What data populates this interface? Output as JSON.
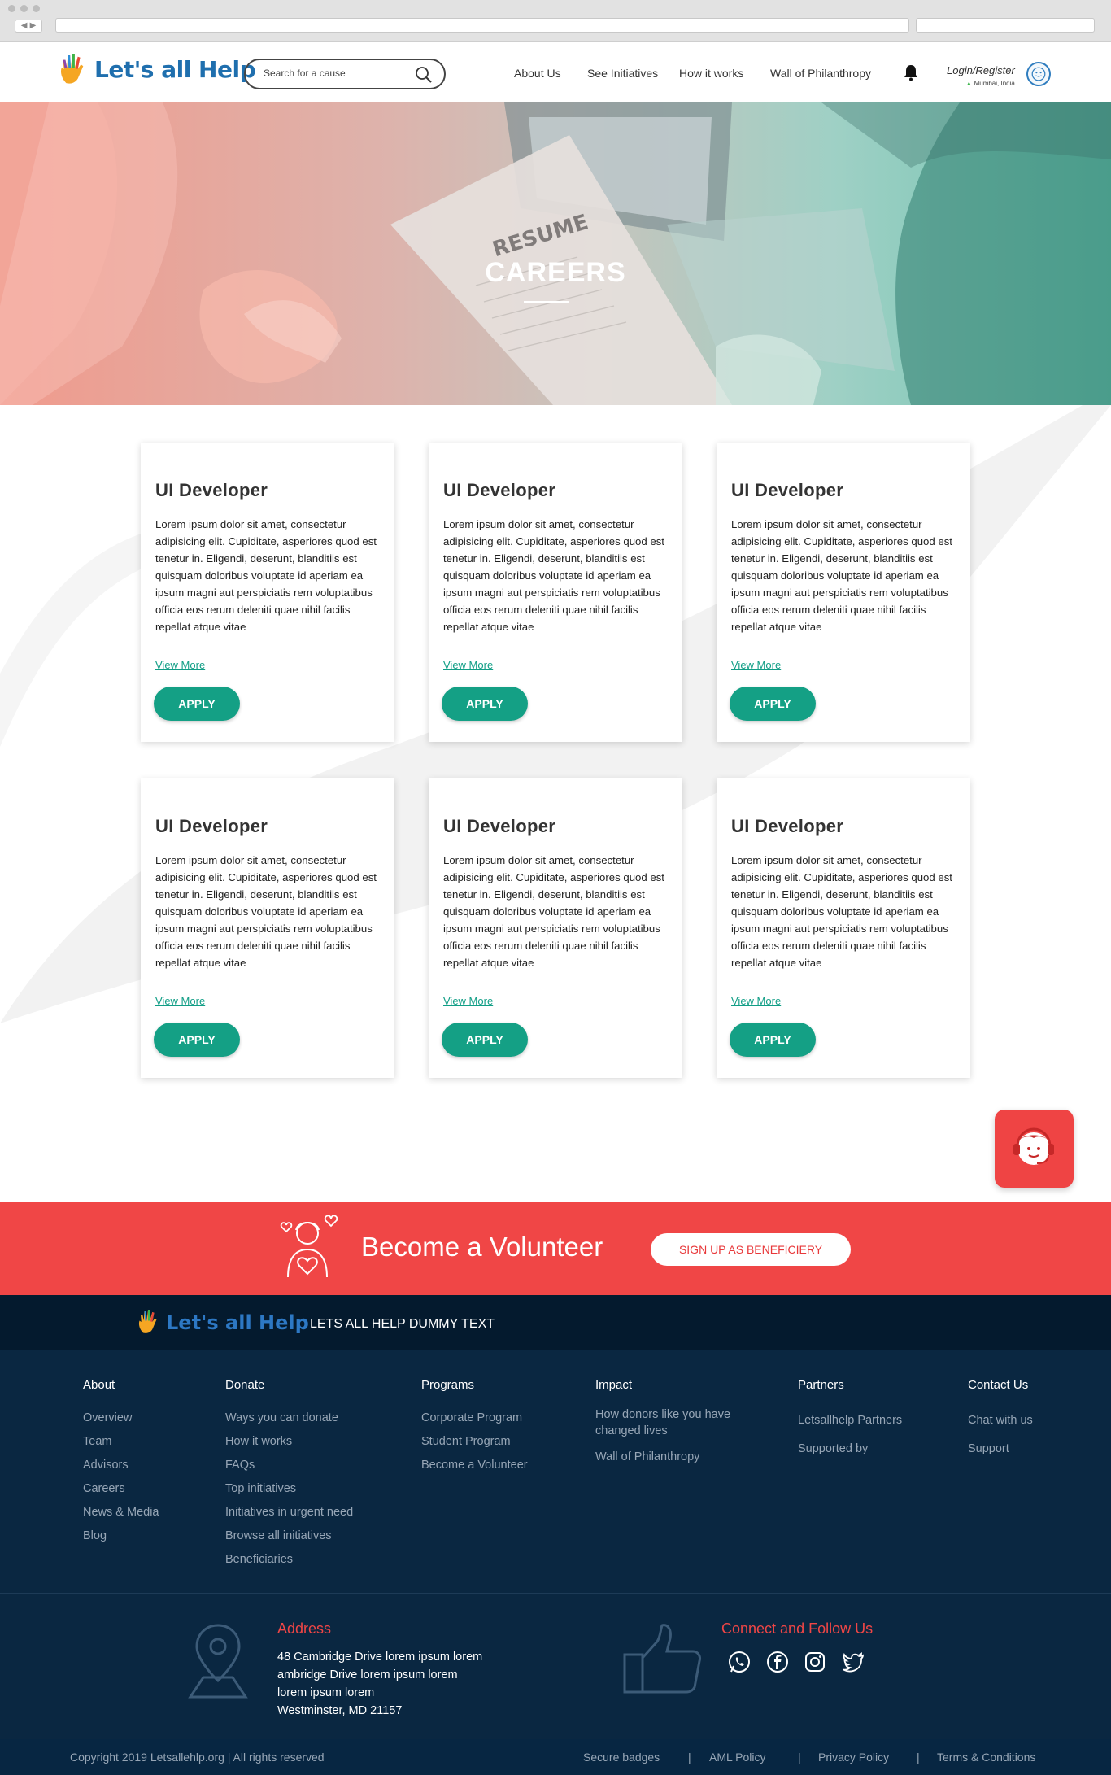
{
  "header": {
    "logo_text": "Let's all Help",
    "search_placeholder": "Search for a cause",
    "nav": [
      "About Us",
      "See Initiatives",
      "How it works",
      "Wall of Philanthropy"
    ],
    "login": "Login/Register",
    "location": "Mumbai, India"
  },
  "hero": {
    "resume_word": "RESUME",
    "title": "CAREERS"
  },
  "jobs": [
    {
      "title": "UI Developer",
      "description": "Lorem ipsum dolor sit amet, consectetur adipisicing elit. Cupiditate, asperiores quod est tenetur in. Eligendi, deserunt, blanditiis est quisquam doloribus voluptate id aperiam ea ipsum magni aut perspiciatis rem voluptatibus officia eos rerum deleniti quae nihil facilis repellat atque vitae",
      "more": "View More",
      "apply": "APPLY"
    },
    {
      "title": "UI Developer",
      "description": "Lorem ipsum dolor sit amet, consectetur adipisicing elit. Cupiditate, asperiores quod est tenetur in. Eligendi, deserunt, blanditiis est quisquam doloribus voluptate id aperiam ea ipsum magni aut perspiciatis rem voluptatibus officia eos rerum deleniti quae nihil facilis repellat atque vitae",
      "more": "View More",
      "apply": "APPLY"
    },
    {
      "title": "UI Developer",
      "description": "Lorem ipsum dolor sit amet, consectetur adipisicing elit. Cupiditate, asperiores quod est tenetur in. Eligendi, deserunt, blanditiis est quisquam doloribus voluptate id aperiam ea ipsum magni aut perspiciatis rem voluptatibus officia eos rerum deleniti quae nihil facilis repellat atque vitae",
      "more": "View More",
      "apply": "APPLY"
    },
    {
      "title": "UI Developer",
      "description": "Lorem ipsum dolor sit amet, consectetur adipisicing elit. Cupiditate, asperiores quod est tenetur in. Eligendi, deserunt, blanditiis est quisquam doloribus voluptate id aperiam ea ipsum magni aut perspiciatis rem voluptatibus officia eos rerum deleniti quae nihil facilis repellat atque vitae",
      "more": "View More",
      "apply": "APPLY"
    },
    {
      "title": "UI Developer",
      "description": "Lorem ipsum dolor sit amet, consectetur adipisicing elit. Cupiditate, asperiores quod est tenetur in. Eligendi, deserunt, blanditiis est quisquam doloribus voluptate id aperiam ea ipsum magni aut perspiciatis rem voluptatibus officia eos rerum deleniti quae nihil facilis repellat atque vitae",
      "more": "View More",
      "apply": "APPLY"
    },
    {
      "title": "UI Developer",
      "description": "Lorem ipsum dolor sit amet, consectetur adipisicing elit. Cupiditate, asperiores quod est tenetur in. Eligendi, deserunt, blanditiis est quisquam doloribus voluptate id aperiam ea ipsum magni aut perspiciatis rem voluptatibus officia eos rerum deleniti quae nihil facilis repellat atque vitae",
      "more": "View More",
      "apply": "APPLY"
    }
  ],
  "volunteer": {
    "text": "Become a Volunteer",
    "button": "SIGN UP AS BENEFICIERY"
  },
  "brand_strip": {
    "logo_text": "Let's all Help",
    "dummy": "LETS ALL HELP DUMMY TEXT"
  },
  "footer": {
    "columns": [
      {
        "heading": "About",
        "links": [
          "Overview",
          "Team",
          "Advisors",
          "Careers",
          "News & Media",
          "Blog"
        ]
      },
      {
        "heading": "Donate",
        "links": [
          "Ways you can donate",
          "How it works",
          "FAQs",
          "Top initiatives",
          "Initiatives in urgent need",
          "Browse all initiatives",
          "Beneficiaries"
        ]
      },
      {
        "heading": "Programs",
        "links": [
          "Corporate Program",
          "Student Program",
          "Become a Volunteer"
        ]
      },
      {
        "heading": "Impact",
        "links": [
          "How donors like you have changed lives",
          "Wall of Philanthropy"
        ]
      },
      {
        "heading": "Partners",
        "links": [
          "Letsallhelp Partners",
          "Supported by"
        ]
      },
      {
        "heading": "Contact Us",
        "links": [
          "Chat with us",
          "Support"
        ]
      }
    ],
    "address_title": "Address",
    "address_lines": [
      "48 Cambridge Drive lorem ipsum lorem",
      "ambridge Drive lorem ipsum lorem",
      "lorem ipsum lorem",
      "Westminster, MD 21157"
    ],
    "follow_title": "Connect and Follow Us",
    "social_icons": [
      "whatsapp-icon",
      "facebook-icon",
      "instagram-icon",
      "twitter-icon"
    ]
  },
  "bottom": {
    "copyright": "Copyright 2019 Letsallehlp.org | All rights reserved",
    "links": [
      "Secure badges",
      "AML Policy",
      "Privacy Policy",
      "Terms & Conditions"
    ],
    "separator": "|"
  },
  "colors": {
    "accent_teal": "#14a085",
    "accent_red": "#f04646",
    "footer_navy": "#0a2741"
  }
}
